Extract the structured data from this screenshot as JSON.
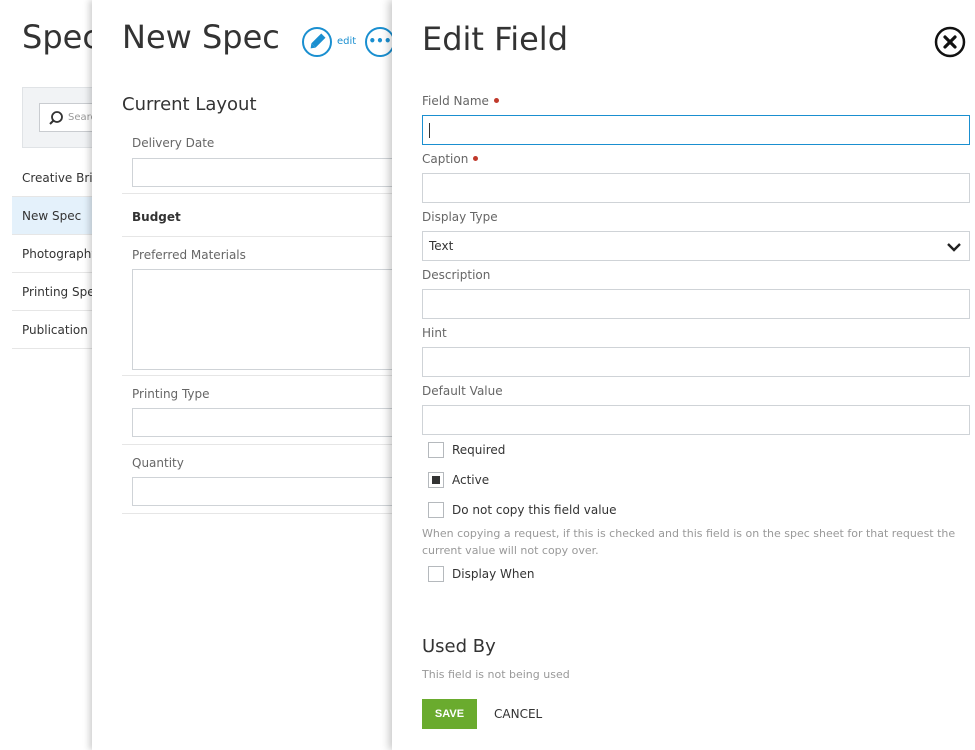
{
  "background_panel": {
    "title": "Spec",
    "search_placeholder": "Search",
    "items": [
      {
        "label": "Creative Brief"
      },
      {
        "label": "New Spec"
      },
      {
        "label": "Photography"
      },
      {
        "label": "Printing Spec"
      },
      {
        "label": "Publication S"
      }
    ],
    "active_index": 1
  },
  "spec_panel": {
    "title": "New Spec",
    "edit_label": "edit",
    "more_label": "•••",
    "section_title": "Current Layout",
    "fields": [
      {
        "label": "Delivery Date"
      },
      {
        "label": "Budget"
      },
      {
        "label": "Preferred Materials"
      },
      {
        "label": "Printing Type"
      },
      {
        "label": "Quantity"
      }
    ]
  },
  "edit_panel": {
    "title": "Edit Field",
    "field_name": {
      "label": "Field Name",
      "value": "",
      "required": true
    },
    "caption": {
      "label": "Caption",
      "value": "",
      "required": true
    },
    "display_type": {
      "label": "Display Type",
      "value": "Text"
    },
    "description": {
      "label": "Description",
      "value": ""
    },
    "hint": {
      "label": "Hint",
      "value": ""
    },
    "default_value": {
      "label": "Default Value",
      "value": ""
    },
    "checkboxes": {
      "required": {
        "label": "Required",
        "checked": false
      },
      "active": {
        "label": "Active",
        "checked": true
      },
      "no_copy": {
        "label": "Do not copy this field value",
        "checked": false
      },
      "display_when": {
        "label": "Display When",
        "checked": false
      }
    },
    "help_text": "When copying a request, if this is checked and this field is on the spec sheet for that request the current value will not copy over.",
    "used_by": {
      "title": "Used By",
      "text": "This field is not being used"
    },
    "save_label": "SAVE",
    "cancel_label": "CANCEL"
  },
  "colors": {
    "accent": "#1a8fd0",
    "save": "#6aab2e",
    "required_dot": "#c0392b"
  }
}
